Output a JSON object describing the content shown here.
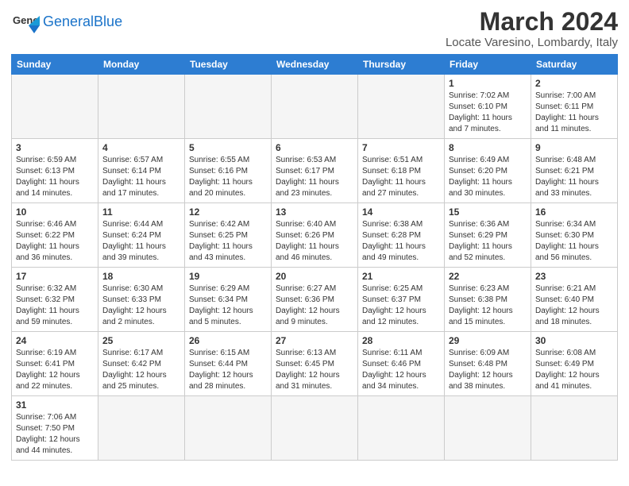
{
  "logo": {
    "general": "General",
    "blue": "Blue"
  },
  "header": {
    "title": "March 2024",
    "subtitle": "Locate Varesino, Lombardy, Italy"
  },
  "weekdays": [
    "Sunday",
    "Monday",
    "Tuesday",
    "Wednesday",
    "Thursday",
    "Friday",
    "Saturday"
  ],
  "weeks": [
    [
      {
        "day": "",
        "info": ""
      },
      {
        "day": "",
        "info": ""
      },
      {
        "day": "",
        "info": ""
      },
      {
        "day": "",
        "info": ""
      },
      {
        "day": "",
        "info": ""
      },
      {
        "day": "1",
        "info": "Sunrise: 7:02 AM\nSunset: 6:10 PM\nDaylight: 11 hours\nand 7 minutes."
      },
      {
        "day": "2",
        "info": "Sunrise: 7:00 AM\nSunset: 6:11 PM\nDaylight: 11 hours\nand 11 minutes."
      }
    ],
    [
      {
        "day": "3",
        "info": "Sunrise: 6:59 AM\nSunset: 6:13 PM\nDaylight: 11 hours\nand 14 minutes."
      },
      {
        "day": "4",
        "info": "Sunrise: 6:57 AM\nSunset: 6:14 PM\nDaylight: 11 hours\nand 17 minutes."
      },
      {
        "day": "5",
        "info": "Sunrise: 6:55 AM\nSunset: 6:16 PM\nDaylight: 11 hours\nand 20 minutes."
      },
      {
        "day": "6",
        "info": "Sunrise: 6:53 AM\nSunset: 6:17 PM\nDaylight: 11 hours\nand 23 minutes."
      },
      {
        "day": "7",
        "info": "Sunrise: 6:51 AM\nSunset: 6:18 PM\nDaylight: 11 hours\nand 27 minutes."
      },
      {
        "day": "8",
        "info": "Sunrise: 6:49 AM\nSunset: 6:20 PM\nDaylight: 11 hours\nand 30 minutes."
      },
      {
        "day": "9",
        "info": "Sunrise: 6:48 AM\nSunset: 6:21 PM\nDaylight: 11 hours\nand 33 minutes."
      }
    ],
    [
      {
        "day": "10",
        "info": "Sunrise: 6:46 AM\nSunset: 6:22 PM\nDaylight: 11 hours\nand 36 minutes."
      },
      {
        "day": "11",
        "info": "Sunrise: 6:44 AM\nSunset: 6:24 PM\nDaylight: 11 hours\nand 39 minutes."
      },
      {
        "day": "12",
        "info": "Sunrise: 6:42 AM\nSunset: 6:25 PM\nDaylight: 11 hours\nand 43 minutes."
      },
      {
        "day": "13",
        "info": "Sunrise: 6:40 AM\nSunset: 6:26 PM\nDaylight: 11 hours\nand 46 minutes."
      },
      {
        "day": "14",
        "info": "Sunrise: 6:38 AM\nSunset: 6:28 PM\nDaylight: 11 hours\nand 49 minutes."
      },
      {
        "day": "15",
        "info": "Sunrise: 6:36 AM\nSunset: 6:29 PM\nDaylight: 11 hours\nand 52 minutes."
      },
      {
        "day": "16",
        "info": "Sunrise: 6:34 AM\nSunset: 6:30 PM\nDaylight: 11 hours\nand 56 minutes."
      }
    ],
    [
      {
        "day": "17",
        "info": "Sunrise: 6:32 AM\nSunset: 6:32 PM\nDaylight: 11 hours\nand 59 minutes."
      },
      {
        "day": "18",
        "info": "Sunrise: 6:30 AM\nSunset: 6:33 PM\nDaylight: 12 hours\nand 2 minutes."
      },
      {
        "day": "19",
        "info": "Sunrise: 6:29 AM\nSunset: 6:34 PM\nDaylight: 12 hours\nand 5 minutes."
      },
      {
        "day": "20",
        "info": "Sunrise: 6:27 AM\nSunset: 6:36 PM\nDaylight: 12 hours\nand 9 minutes."
      },
      {
        "day": "21",
        "info": "Sunrise: 6:25 AM\nSunset: 6:37 PM\nDaylight: 12 hours\nand 12 minutes."
      },
      {
        "day": "22",
        "info": "Sunrise: 6:23 AM\nSunset: 6:38 PM\nDaylight: 12 hours\nand 15 minutes."
      },
      {
        "day": "23",
        "info": "Sunrise: 6:21 AM\nSunset: 6:40 PM\nDaylight: 12 hours\nand 18 minutes."
      }
    ],
    [
      {
        "day": "24",
        "info": "Sunrise: 6:19 AM\nSunset: 6:41 PM\nDaylight: 12 hours\nand 22 minutes."
      },
      {
        "day": "25",
        "info": "Sunrise: 6:17 AM\nSunset: 6:42 PM\nDaylight: 12 hours\nand 25 minutes."
      },
      {
        "day": "26",
        "info": "Sunrise: 6:15 AM\nSunset: 6:44 PM\nDaylight: 12 hours\nand 28 minutes."
      },
      {
        "day": "27",
        "info": "Sunrise: 6:13 AM\nSunset: 6:45 PM\nDaylight: 12 hours\nand 31 minutes."
      },
      {
        "day": "28",
        "info": "Sunrise: 6:11 AM\nSunset: 6:46 PM\nDaylight: 12 hours\nand 34 minutes."
      },
      {
        "day": "29",
        "info": "Sunrise: 6:09 AM\nSunset: 6:48 PM\nDaylight: 12 hours\nand 38 minutes."
      },
      {
        "day": "30",
        "info": "Sunrise: 6:08 AM\nSunset: 6:49 PM\nDaylight: 12 hours\nand 41 minutes."
      }
    ],
    [
      {
        "day": "31",
        "info": "Sunrise: 7:06 AM\nSunset: 7:50 PM\nDaylight: 12 hours\nand 44 minutes."
      },
      {
        "day": "",
        "info": ""
      },
      {
        "day": "",
        "info": ""
      },
      {
        "day": "",
        "info": ""
      },
      {
        "day": "",
        "info": ""
      },
      {
        "day": "",
        "info": ""
      },
      {
        "day": "",
        "info": ""
      }
    ]
  ]
}
